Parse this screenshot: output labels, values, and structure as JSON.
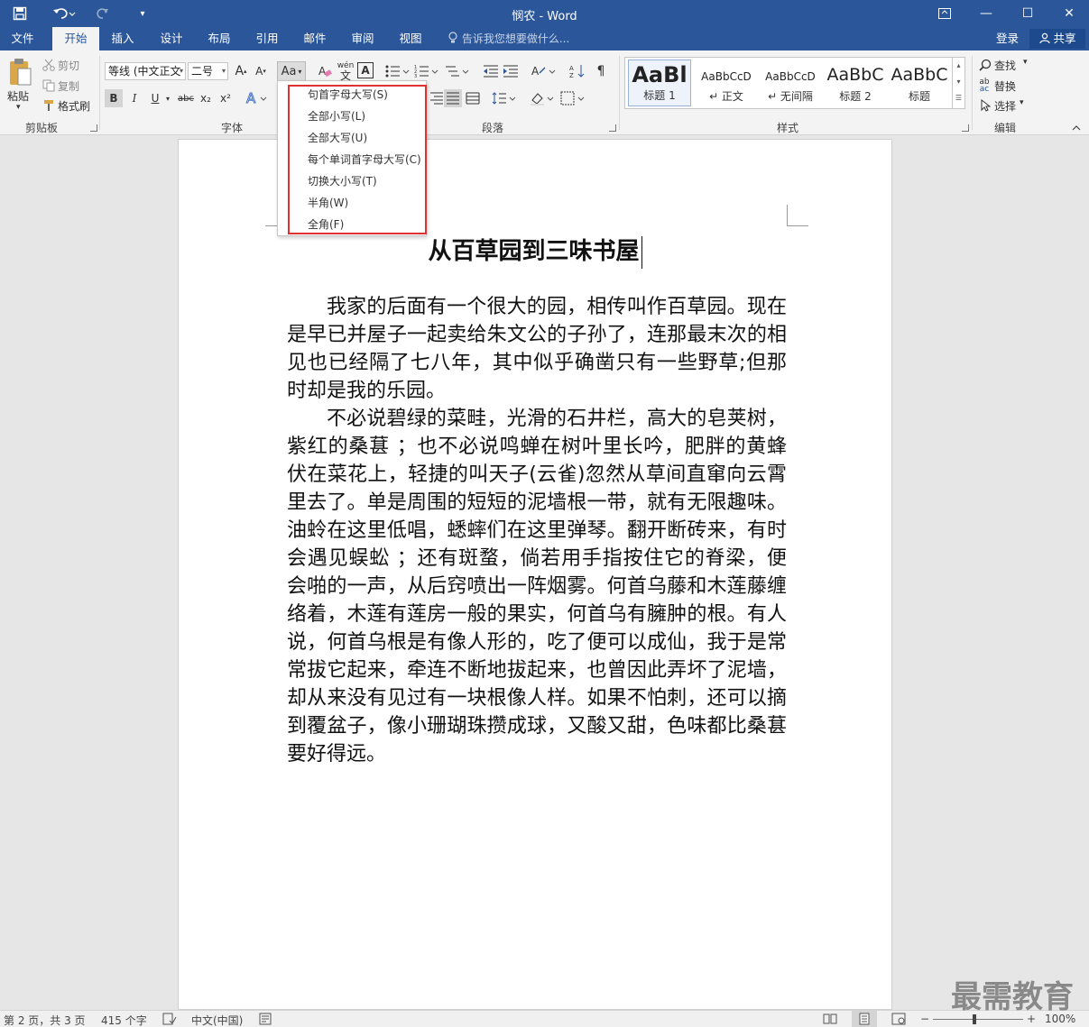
{
  "window": {
    "title": "悯农 - Word",
    "minimize_icon": "—",
    "maximize_icon": "☐",
    "close_icon": "✕"
  },
  "tabs": [
    {
      "label": "文件"
    },
    {
      "label": "开始"
    },
    {
      "label": "插入"
    },
    {
      "label": "设计"
    },
    {
      "label": "布局"
    },
    {
      "label": "引用"
    },
    {
      "label": "邮件"
    },
    {
      "label": "审阅"
    },
    {
      "label": "视图"
    }
  ],
  "tell_me": "告诉我您想要做什么...",
  "login": "登录",
  "share": "共享",
  "clipboard": {
    "paste": "粘贴",
    "cut": "剪切",
    "copy": "复制",
    "format_painter": "格式刷",
    "group": "剪贴板"
  },
  "font": {
    "name": "等线 (中文正文",
    "size": "二号",
    "group": "字体",
    "bold": "B",
    "italic": "I",
    "underline": "U",
    "strike": "abc",
    "sub": "x₂",
    "sup": "x²",
    "grow": "A",
    "shrink": "A",
    "case": "Aa",
    "phonetic": "wén",
    "border_char": "A"
  },
  "paragraph": {
    "group": "段落"
  },
  "styles": {
    "group": "样式",
    "items": [
      {
        "sample": "AaBl",
        "name": "标题 1"
      },
      {
        "sample": "AaBbCcD",
        "name": "↵ 正文"
      },
      {
        "sample": "AaBbCcD",
        "name": "↵ 无间隔"
      },
      {
        "sample": "AaBbC",
        "name": "标题 2"
      },
      {
        "sample": "AaBbC",
        "name": "标题"
      }
    ]
  },
  "editing": {
    "find": "查找",
    "replace": "替换",
    "select": "选择",
    "group": "编辑"
  },
  "case_menu": {
    "items": [
      {
        "label": "句首字母大写(S)"
      },
      {
        "label": "全部小写(L)"
      },
      {
        "label": "全部大写(U)"
      },
      {
        "label": "每个单词首字母大写(C)"
      },
      {
        "label": "切换大小写(T)"
      },
      {
        "label": "半角(W)"
      },
      {
        "label": "全角(F)"
      }
    ]
  },
  "document": {
    "heading": "从百草园到三味书屋",
    "paragraphs": [
      "我家的后面有一个很大的园，相传叫作百草园。现在是早已并屋子一起卖给朱文公的子孙了，连那最末次的相见也已经隔了七八年，其中似乎确凿只有一些野草;但那时却是我的乐园。",
      "不必说碧绿的菜畦，光滑的石井栏，高大的皂荚树，紫红的桑葚 ；也不必说鸣蝉在树叶里长吟，肥胖的黄蜂伏在菜花上，轻捷的叫天子(云雀)忽然从草间直窜向云霄里去了。单是周围的短短的泥墙根一带，就有无限趣味。油蛉在这里低唱，蟋蟀们在这里弹琴。翻开断砖来，有时会遇见蜈蚣 ；还有斑蝥，倘若用手指按住它的脊梁，便会啪的一声，从后窍喷出一阵烟雾。何首乌藤和木莲藤缠络着，木莲有莲房一般的果实，何首乌有臃肿的根。有人说，何首乌根是有像人形的，吃了便可以成仙，我于是常常拔它起来，牵连不断地拔起来，也曾因此弄坏了泥墙，却从来没有见过有一块根像人样。如果不怕刺，还可以摘到覆盆子，像小珊瑚珠攒成球，又酸又甜，色味都比桑葚要好得远。"
    ]
  },
  "status": {
    "page": "第 2 页，共 3 页",
    "words": "415 个字",
    "language": "中文(中国)",
    "zoom": "100%"
  },
  "watermark": "最需教育",
  "colors": {
    "accent": "#2b579a",
    "highlight_border": "#e0302f"
  }
}
